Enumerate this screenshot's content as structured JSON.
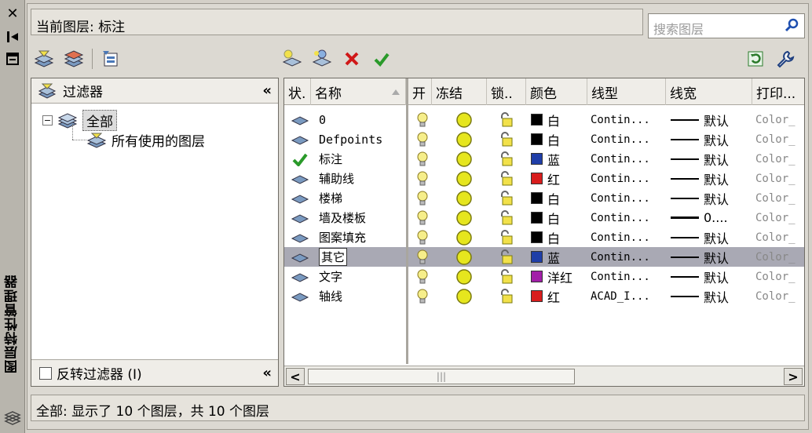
{
  "window": {
    "side_title": "图层特性管理器"
  },
  "current_layer": {
    "label": "当前图层: 标注"
  },
  "search": {
    "placeholder": "搜索图层"
  },
  "filter_panel": {
    "header": "过滤器",
    "tree": [
      {
        "label": "全部",
        "expanded": true,
        "selected": true
      },
      {
        "label": "所有使用的图层"
      }
    ],
    "invert_label": "反转过滤器 (I)"
  },
  "columns": [
    "状.",
    "名称",
    "开",
    "冻结",
    "锁..",
    "颜色",
    "线型",
    "线宽",
    "打印..."
  ],
  "layers": [
    {
      "name": "0",
      "current": false,
      "color_hex": "#000000",
      "color_name": "白",
      "linetype": "Contin...",
      "lineweight": "默认",
      "plot_style": "Color_"
    },
    {
      "name": "Defpoints",
      "current": false,
      "color_hex": "#000000",
      "color_name": "白",
      "linetype": "Contin...",
      "lineweight": "默认",
      "plot_style": "Color_"
    },
    {
      "name": "标注",
      "current": true,
      "color_hex": "#1f3ea8",
      "color_name": "蓝",
      "linetype": "Contin...",
      "lineweight": "默认",
      "plot_style": "Color_"
    },
    {
      "name": "辅助线",
      "current": false,
      "color_hex": "#d81d1d",
      "color_name": "红",
      "linetype": "Contin...",
      "lineweight": "默认",
      "plot_style": "Color_"
    },
    {
      "name": "楼梯",
      "current": false,
      "color_hex": "#000000",
      "color_name": "白",
      "linetype": "Contin...",
      "lineweight": "默认",
      "plot_style": "Color_"
    },
    {
      "name": "墙及楼板",
      "current": false,
      "color_hex": "#000000",
      "color_name": "白",
      "linetype": "Contin...",
      "lineweight": "0....",
      "plot_style": "Color_"
    },
    {
      "name": "图案填充",
      "current": false,
      "color_hex": "#000000",
      "color_name": "白",
      "linetype": "Contin...",
      "lineweight": "默认",
      "plot_style": "Color_"
    },
    {
      "name": "其它",
      "current": false,
      "selected": true,
      "color_hex": "#1f3ea8",
      "color_name": "蓝",
      "linetype": "Contin...",
      "lineweight": "默认",
      "plot_style": "Color_"
    },
    {
      "name": "文字",
      "current": false,
      "color_hex": "#a21fa8",
      "color_name": "洋红",
      "linetype": "Contin...",
      "lineweight": "默认",
      "plot_style": "Color_"
    },
    {
      "name": "轴线",
      "current": false,
      "color_hex": "#d81d1d",
      "color_name": "红",
      "linetype": "ACAD_I...",
      "lineweight": "默认",
      "plot_style": "Color_"
    }
  ],
  "status": {
    "text": "全部: 显示了 10 个图层，共 10 个图层"
  },
  "colors": {
    "selected_row": "#a9a9b4",
    "bulb": "#f2e14a",
    "sun": "#e6e61e",
    "check": "#2a9a2a",
    "delete": "#d01818"
  }
}
